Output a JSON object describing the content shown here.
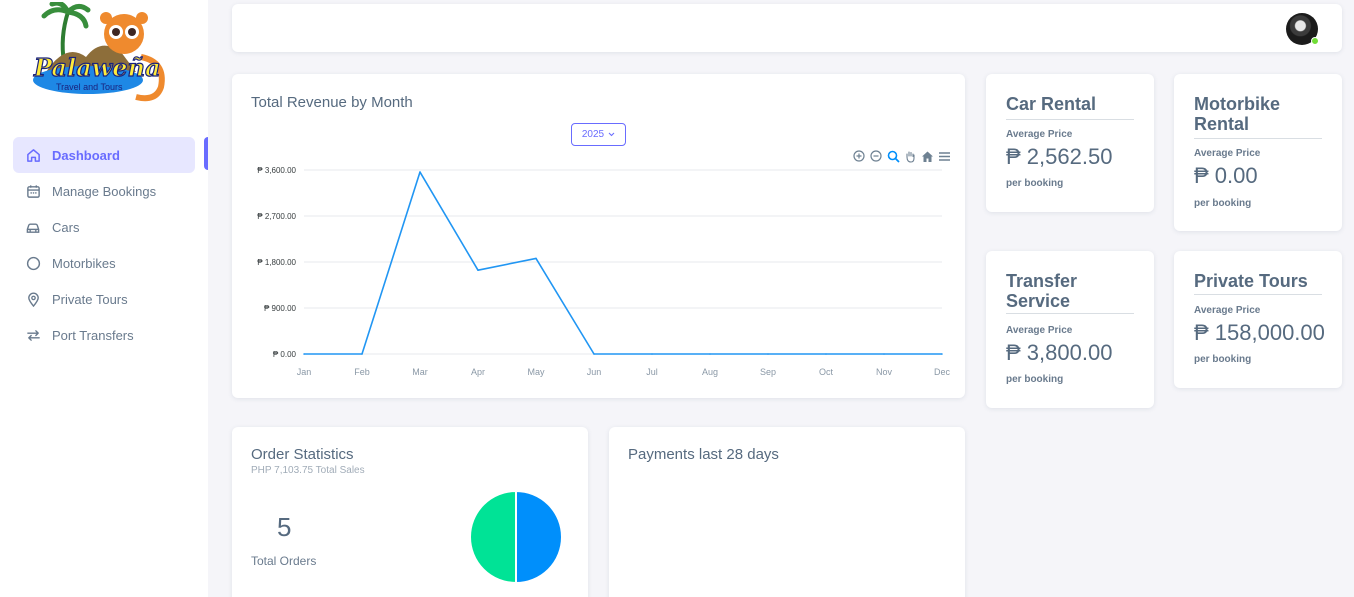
{
  "brand": {
    "name": "Palaweña",
    "tagline": "Travel and Tours"
  },
  "sidebar": {
    "items": [
      {
        "label": "Dashboard",
        "icon": "home-icon",
        "active": true
      },
      {
        "label": "Manage Bookings",
        "icon": "calendar-icon",
        "active": false
      },
      {
        "label": "Cars",
        "icon": "car-icon",
        "active": false
      },
      {
        "label": "Motorbikes",
        "icon": "circle-icon",
        "active": false
      },
      {
        "label": "Private Tours",
        "icon": "map-pin-icon",
        "active": false
      },
      {
        "label": "Port Transfers",
        "icon": "transfer-icon",
        "active": false
      }
    ]
  },
  "revenue": {
    "title": "Total Revenue by Month",
    "year": "2025",
    "toolbar": [
      "zoom-in-icon",
      "zoom-out-icon",
      "zoom-select-icon",
      "pan-icon",
      "reset-home-icon",
      "menu-icon"
    ]
  },
  "chart_data": {
    "type": "line",
    "categories": [
      "Jan",
      "Feb",
      "Mar",
      "Apr",
      "May",
      "Jun",
      "Jul",
      "Aug",
      "Sep",
      "Oct",
      "Nov",
      "Dec"
    ],
    "series": [
      {
        "values": [
          0,
          0,
          3560,
          1640,
          1870,
          0,
          0,
          0,
          0,
          0,
          0,
          0
        ]
      }
    ],
    "yticks": [
      "₱ 3,600.00",
      "₱ 2,700.00",
      "₱ 1,800.00",
      "₱ 900.00",
      "₱ 0.00"
    ],
    "ylim": [
      0,
      3600
    ],
    "grid": true,
    "color": "#2196f3"
  },
  "stats": {
    "car": {
      "title": "Car Rental",
      "sub": "Average Price",
      "value": "₱ 2,562.50",
      "foot": "per booking"
    },
    "motorbike": {
      "title": "Motorbike Rental",
      "sub": "Average Price",
      "value": "₱ 0.00",
      "foot": "per booking"
    },
    "transfer": {
      "title": "Transfer Service",
      "sub": "Average Price",
      "value": "₱ 3,800.00",
      "foot": "per booking"
    },
    "tours": {
      "title": "Private Tours",
      "sub": "Average Price",
      "value": "₱ 158,000.00",
      "foot": "per booking"
    }
  },
  "orders": {
    "title": "Order Statistics",
    "sub": "PHP 7,103.75 Total Sales",
    "count": "5",
    "count_label": "Total Orders",
    "pie": [
      {
        "value": 50,
        "color": "#008ffb"
      },
      {
        "value": 50,
        "color": "#00e396"
      }
    ]
  },
  "payments": {
    "title": "Payments last 28 days"
  },
  "colors": {
    "accent": "#696cff",
    "online": "#71dd37"
  }
}
